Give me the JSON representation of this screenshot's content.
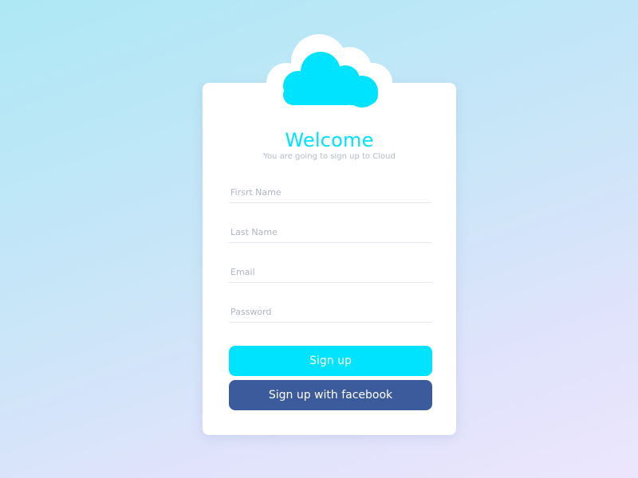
{
  "theme": {
    "accent": "#00e3ff",
    "facebook": "#3b5b9c"
  },
  "header": {
    "logo_icon": "cloud-icon",
    "title": "Welcome",
    "subtitle": "You are going to sign up to Cloud"
  },
  "form": {
    "fields": [
      {
        "placeholder": "Firsrt Name",
        "value": ""
      },
      {
        "placeholder": "Last Name",
        "value": ""
      },
      {
        "placeholder": "Email",
        "value": ""
      },
      {
        "placeholder": "Password",
        "value": ""
      }
    ],
    "signup_label": "Sign up",
    "facebook_label": "Sign up with facebook"
  }
}
